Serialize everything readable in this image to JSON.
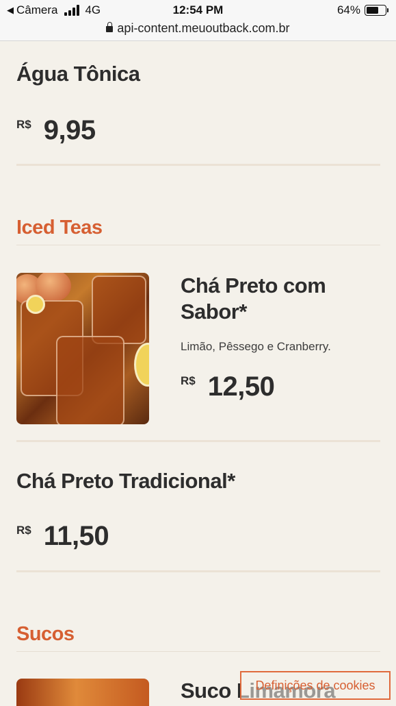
{
  "status_bar": {
    "back_label": "Câmera",
    "network": "4G",
    "time": "12:54 PM",
    "battery": "64%",
    "battery_level": 0.64
  },
  "browser": {
    "url": "api-content.meuoutback.com.br"
  },
  "menu": {
    "item_agua": {
      "name": "Água Tônica",
      "currency": "R$",
      "price": "9,95"
    },
    "section_iced_teas": "Iced Teas",
    "item_cha_sabor": {
      "name_line1": "Chá Preto com",
      "name_line2": "Sabor*",
      "description": "Limão, Pêssego e Cranberry.",
      "currency": "R$",
      "price": "12,50"
    },
    "item_cha_tradicional": {
      "name": "Chá Preto Tradicional*",
      "currency": "R$",
      "price": "11,50"
    },
    "section_sucos": "Sucos",
    "item_suco": {
      "name": "Suco Limamora"
    }
  },
  "cookie_button": {
    "label": "Definições de cookies"
  },
  "colors": {
    "background": "#f4f1ea",
    "section_accent": "#d65f32",
    "divider": "#ebe2d5",
    "text": "#2d2d2d"
  }
}
